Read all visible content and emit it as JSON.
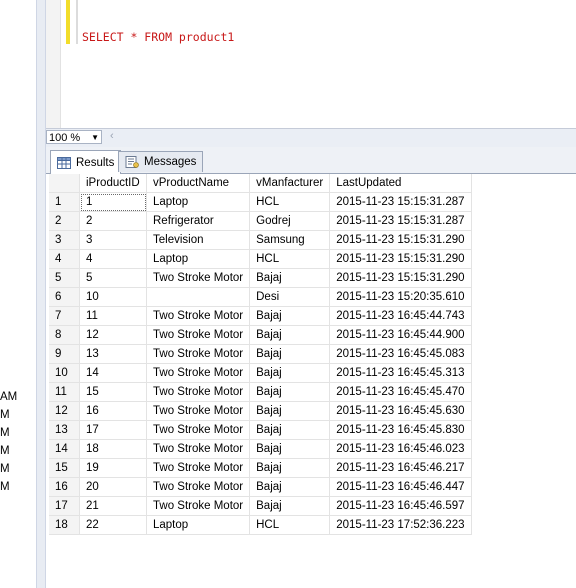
{
  "left_panel": {
    "fragments": [
      "AM",
      "M",
      "M",
      "M",
      "M",
      "M"
    ]
  },
  "editor": {
    "query": "SELECT * FROM product1"
  },
  "zoom": {
    "value": "100 %"
  },
  "tabs": [
    {
      "label": "Results",
      "icon": "grid-icon",
      "active": true
    },
    {
      "label": "Messages",
      "icon": "messages-icon",
      "active": false
    }
  ],
  "results": {
    "columns": [
      "iProductID",
      "vProductName",
      "vManfacturer",
      "LastUpdated"
    ],
    "rows": [
      [
        "1",
        "1",
        "Laptop",
        "HCL",
        "2015-11-23 15:15:31.287"
      ],
      [
        "2",
        "2",
        "Refrigerator",
        "Godrej",
        "2015-11-23 15:15:31.287"
      ],
      [
        "3",
        "3",
        "Television",
        "Samsung",
        "2015-11-23 15:15:31.290"
      ],
      [
        "4",
        "4",
        "Laptop",
        "HCL",
        "2015-11-23 15:15:31.290"
      ],
      [
        "5",
        "5",
        "Two Stroke Motor",
        "Bajaj",
        "2015-11-23 15:15:31.290"
      ],
      [
        "6",
        "10",
        "",
        "Desi",
        "2015-11-23 15:20:35.610"
      ],
      [
        "7",
        "11",
        "Two Stroke Motor",
        "Bajaj",
        "2015-11-23 16:45:44.743"
      ],
      [
        "8",
        "12",
        "Two Stroke Motor",
        "Bajaj",
        "2015-11-23 16:45:44.900"
      ],
      [
        "9",
        "13",
        "Two Stroke Motor",
        "Bajaj",
        "2015-11-23 16:45:45.083"
      ],
      [
        "10",
        "14",
        "Two Stroke Motor",
        "Bajaj",
        "2015-11-23 16:45:45.313"
      ],
      [
        "11",
        "15",
        "Two Stroke Motor",
        "Bajaj",
        "2015-11-23 16:45:45.470"
      ],
      [
        "12",
        "16",
        "Two Stroke Motor",
        "Bajaj",
        "2015-11-23 16:45:45.630"
      ],
      [
        "13",
        "17",
        "Two Stroke Motor",
        "Bajaj",
        "2015-11-23 16:45:45.830"
      ],
      [
        "14",
        "18",
        "Two Stroke Motor",
        "Bajaj",
        "2015-11-23 16:45:46.023"
      ],
      [
        "15",
        "19",
        "Two Stroke Motor",
        "Bajaj",
        "2015-11-23 16:45:46.217"
      ],
      [
        "16",
        "20",
        "Two Stroke Motor",
        "Bajaj",
        "2015-11-23 16:45:46.447"
      ],
      [
        "17",
        "21",
        "Two Stroke Motor",
        "Bajaj",
        "2015-11-23 16:45:46.597"
      ],
      [
        "18",
        "22",
        "Laptop",
        "HCL",
        "2015-11-23 17:52:36.223"
      ]
    ]
  },
  "colors": {
    "sql_text": "#c81818",
    "change_bar": "#f2dd2a",
    "row_header_bg": "#f4f4f4"
  }
}
